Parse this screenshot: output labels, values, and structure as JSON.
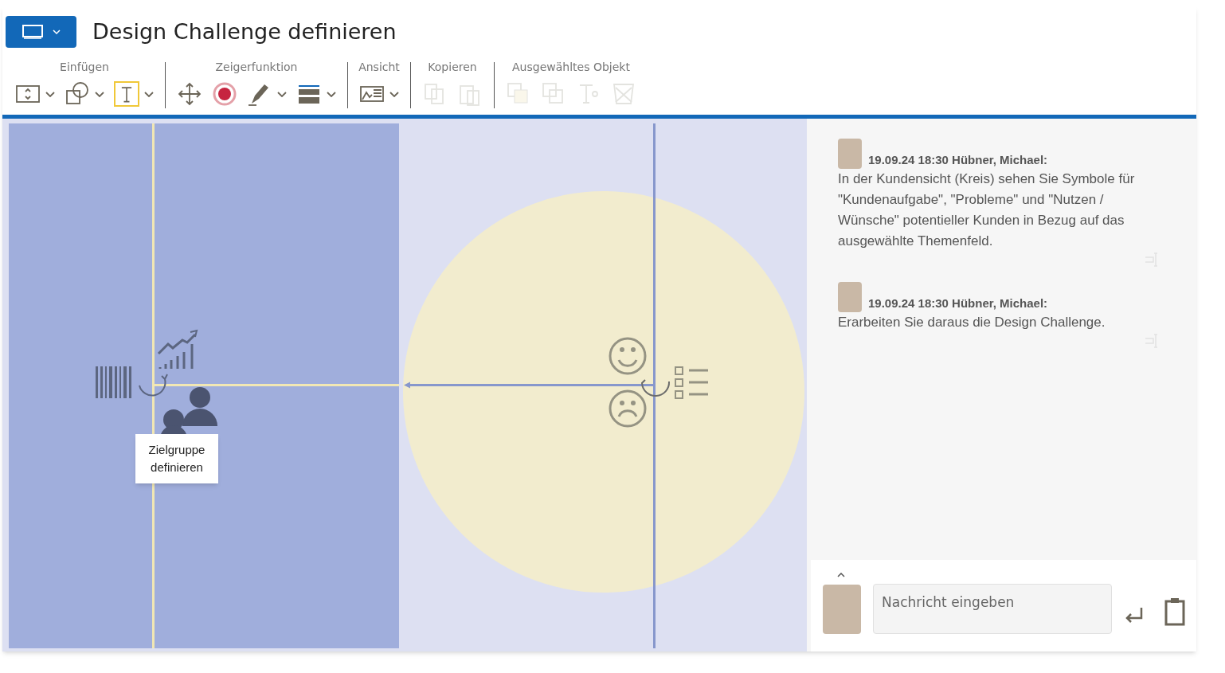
{
  "title": "Design Challenge definieren",
  "toolbar": [
    {
      "label": "Einfügen",
      "tools": [
        {
          "dropdown": true,
          "selected": false,
          "disabled": false
        },
        {
          "dropdown": true,
          "selected": false,
          "disabled": false
        },
        {
          "dropdown": true,
          "selected": true,
          "disabled": false
        }
      ]
    },
    {
      "label": "Zeigerfunktion",
      "tools": [
        {
          "dropdown": false,
          "selected": false,
          "disabled": false
        },
        {
          "dropdown": false,
          "selected": false,
          "disabled": false
        },
        {
          "dropdown": true,
          "selected": false,
          "disabled": false
        },
        {
          "dropdown": true,
          "selected": false,
          "disabled": false
        }
      ]
    },
    {
      "label": "Ansicht",
      "tools": [
        {
          "dropdown": true,
          "selected": false,
          "disabled": false
        }
      ]
    },
    {
      "label": "Kopieren",
      "tools": [
        {
          "dropdown": false,
          "selected": false,
          "disabled": true
        },
        {
          "dropdown": false,
          "selected": false,
          "disabled": true
        }
      ]
    },
    {
      "label": "Ausgewähltes Objekt",
      "tools": [
        {
          "dropdown": false,
          "selected": false,
          "disabled": true
        },
        {
          "dropdown": false,
          "selected": false,
          "disabled": true
        },
        {
          "dropdown": false,
          "selected": false,
          "disabled": true
        },
        {
          "dropdown": false,
          "selected": false,
          "disabled": true
        }
      ]
    }
  ],
  "canvas": {
    "tooltip": "Zielgruppe definieren"
  },
  "comments": [
    {
      "meta": "19.09.24 18:30 Hübner, Michael:",
      "text": "In der Kundensicht (Kreis) sehen Sie Symbole für \"Kundenaufgabe\", \"Probleme\" und \"Nutzen / Wünsche\" potentieller Kunden in Bezug auf das ausgewählte Themenfeld."
    },
    {
      "meta": "19.09.24 18:30 Hübner, Michael:",
      "text": "Erarbeiten Sie daraus die Design Challenge."
    }
  ],
  "chat_input": {
    "placeholder": "Nachricht eingeben"
  }
}
